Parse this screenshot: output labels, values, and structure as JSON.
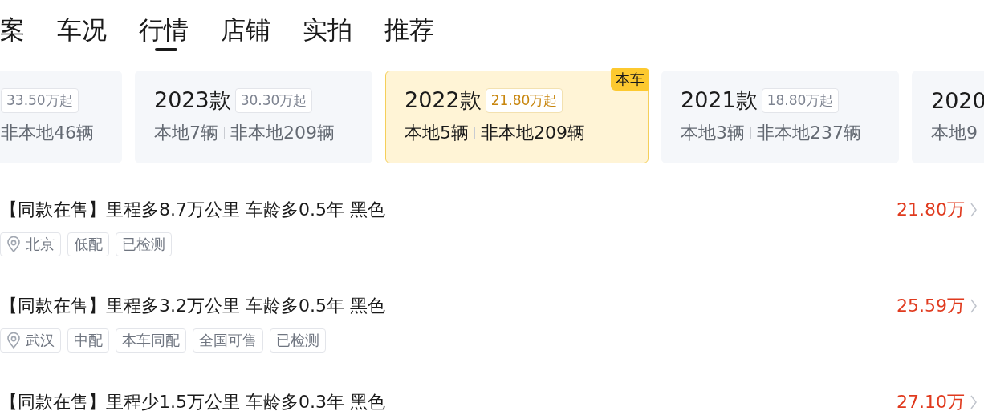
{
  "tabs": [
    {
      "label": "案",
      "selected": false
    },
    {
      "label": "车况",
      "selected": false
    },
    {
      "label": "行情",
      "selected": true
    },
    {
      "label": "店铺",
      "selected": false
    },
    {
      "label": "实拍",
      "selected": false
    },
    {
      "label": "推荐",
      "selected": false
    }
  ],
  "year_cards": [
    {
      "price": "33.50万起",
      "non_local": "非本地46辆",
      "selected": false
    },
    {
      "year": "2023款",
      "price": "30.30万起",
      "local": "本地7辆",
      "non_local": "非本地209辆",
      "selected": false
    },
    {
      "year": "2022款",
      "price": "21.80万起",
      "local": "本地5辆",
      "non_local": "非本地209辆",
      "selected": true,
      "badge": "本车"
    },
    {
      "year": "2021款",
      "price": "18.80万起",
      "local": "本地3辆",
      "non_local": "非本地237辆",
      "selected": false
    },
    {
      "year": "2020",
      "local": "本地9",
      "selected": false
    }
  ],
  "listings": [
    {
      "title": "【同款在售】里程多8.7万公里 车龄多0.5年 黑色",
      "price": "21.80万",
      "tags": [
        {
          "kind": "location",
          "label": "北京"
        },
        {
          "kind": "plain",
          "label": "低配"
        },
        {
          "kind": "plain",
          "label": "已检测"
        }
      ]
    },
    {
      "title": "【同款在售】里程多3.2万公里 车龄多0.5年 黑色",
      "price": "25.59万",
      "tags": [
        {
          "kind": "location",
          "label": "武汉"
        },
        {
          "kind": "plain",
          "label": "中配"
        },
        {
          "kind": "plain",
          "label": "本车同配"
        },
        {
          "kind": "plain",
          "label": "全国可售"
        },
        {
          "kind": "plain",
          "label": "已检测"
        }
      ]
    },
    {
      "title": "【同款在售】里程少1.5万公里 车龄多0.3年 黑色",
      "price": "27.10万"
    }
  ]
}
